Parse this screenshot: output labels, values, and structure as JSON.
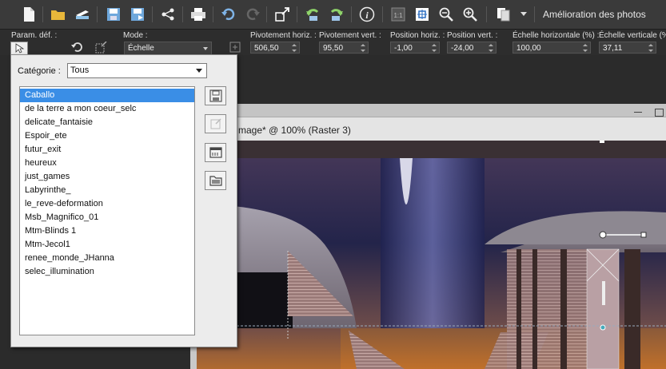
{
  "toolbar": {
    "enhance_label": "Amélioration des photos",
    "icons": [
      "new-icon",
      "open-folder-icon",
      "scan-icon",
      "save-icon",
      "save-as-icon",
      "share-icon",
      "print-icon",
      "undo-icon",
      "redo-icon",
      "resize-icon",
      "rotate-left-icon",
      "rotate-right-icon",
      "info-icon",
      "actual-size-icon",
      "fit-window-icon",
      "zoom-out-icon",
      "zoom-in-icon",
      "copy-icon"
    ]
  },
  "options": {
    "param_label": "Param. déf. :",
    "mode_label": "Mode :",
    "mode_value": "Échelle",
    "fields": [
      {
        "label": "Pivotement horiz. :",
        "value": "506,50"
      },
      {
        "label": "Pivotement vert. :",
        "value": "95,50"
      },
      {
        "label": "Position horiz. :",
        "value": "-1,00"
      },
      {
        "label": "Position vert. :",
        "value": "-24,00"
      },
      {
        "label": "Échelle horizontale (%) :",
        "value": "100,00"
      },
      {
        "label": "Échelle verticale (%) :",
        "value": "37,11"
      }
    ]
  },
  "canvas": {
    "title": "mage* @ 100% (Raster 3)"
  },
  "presets": {
    "category_label": "Catégorie :",
    "category_value": "Tous",
    "items": [
      "Caballo",
      "de la terre a mon coeur_selc",
      "delicate_fantaisie",
      "Espoir_ete",
      "futur_exit",
      "heureux",
      "just_games",
      "Labyrinthe_",
      "le_reve-deformation",
      "Msb_Magnifico_01",
      "Mtm-Blinds 1",
      "Mtm-Jecol1",
      "renee_monde_JHanna",
      "selec_illumination"
    ],
    "selected": "Caballo"
  },
  "colors": {
    "toolbar_bg": "#3a3a3a",
    "selection": "#3a8ee6",
    "panel_bg": "#ececec"
  }
}
